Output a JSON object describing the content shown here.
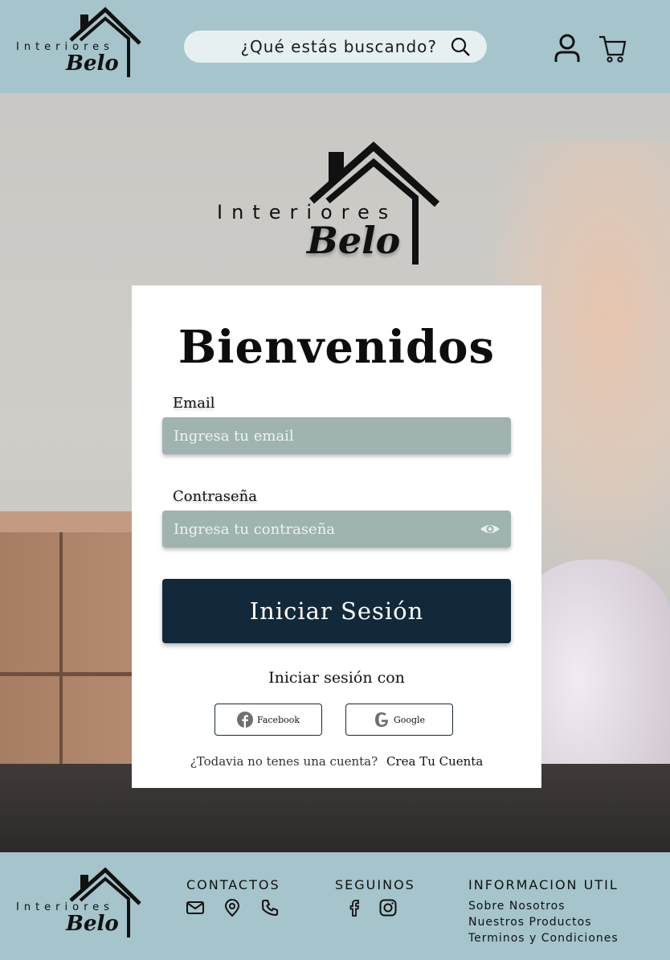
{
  "brand": {
    "top_word": "Interiores",
    "main_word": "Belo"
  },
  "header": {
    "search_placeholder": "¿Qué estás buscando?",
    "icons": [
      "user-icon",
      "cart-icon",
      "search-icon"
    ]
  },
  "login": {
    "title": "Bienvenidos",
    "email_label": "Email",
    "email_placeholder": "Ingresa tu email",
    "password_label": "Contraseña",
    "password_placeholder": "Ingresa tu contraseña",
    "submit_label": "Iniciar Sesión",
    "social_title": "Iniciar sesión con",
    "facebook_label": "Facebook",
    "google_label": "Google",
    "signup_prompt": "¿Todavia no tenes una cuenta?",
    "signup_link": "Crea Tu Cuenta"
  },
  "footer": {
    "contacts_title": "CONTACTOS",
    "follow_title": "SEGUINOS",
    "info_title": "INFORMACION UTIL",
    "info_links": [
      "Sobre Nosotros",
      "Nuestros Productos",
      "Terminos y Condiciones"
    ],
    "contact_icons": [
      "mail-icon",
      "location-icon",
      "phone-icon"
    ],
    "social_icons": [
      "facebook-icon",
      "instagram-icon"
    ]
  },
  "colors": {
    "header_bg": "#a5c4cc",
    "button_bg": "#12283b",
    "field_bg": "#9fb3b0"
  }
}
